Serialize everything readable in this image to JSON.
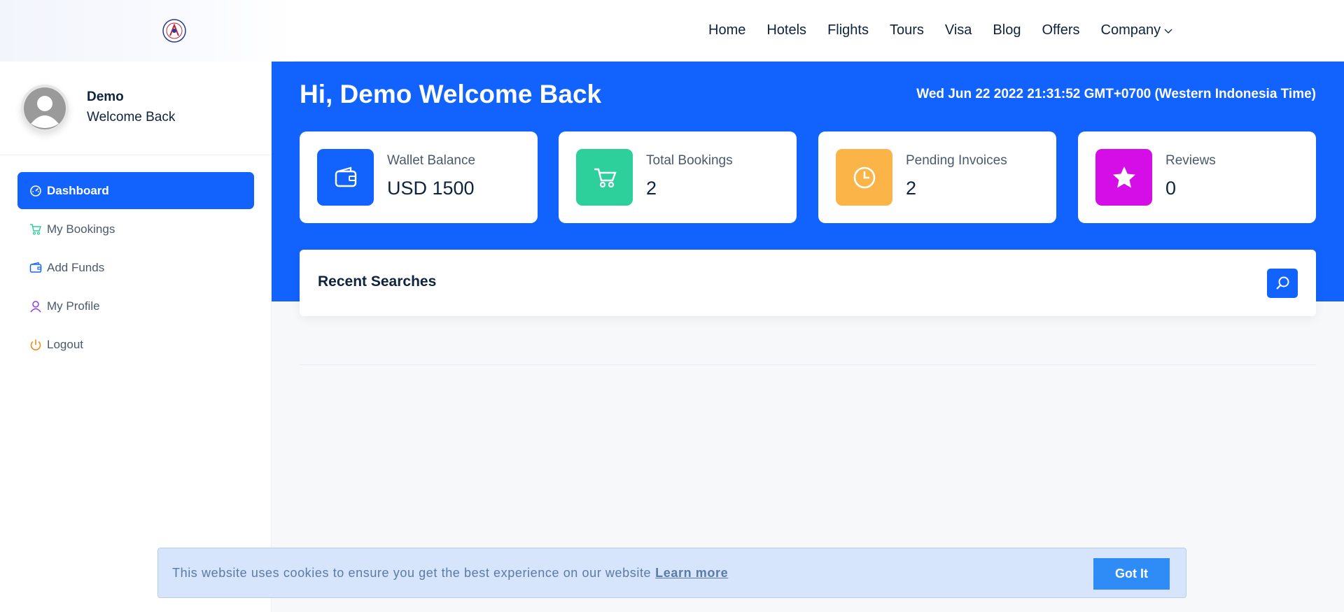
{
  "nav": {
    "items": [
      "Home",
      "Hotels",
      "Flights",
      "Tours",
      "Visa",
      "Blog",
      "Offers",
      "Company"
    ]
  },
  "sidebar": {
    "user_name": "Demo",
    "user_greeting": "Welcome Back",
    "items": [
      {
        "label": "Dashboard",
        "icon": "dashboard-gauge-icon",
        "color": "#ffffff",
        "active": true
      },
      {
        "label": "My Bookings",
        "icon": "cart-icon",
        "color": "#2dd09b",
        "active": false
      },
      {
        "label": "Add Funds",
        "icon": "wallet-icon",
        "color": "#1263fd",
        "active": false
      },
      {
        "label": "My Profile",
        "icon": "user-icon",
        "color": "#8a3cf5",
        "active": false
      },
      {
        "label": "Logout",
        "icon": "power-icon",
        "color": "#f08a1c",
        "active": false
      }
    ]
  },
  "hero": {
    "title": "Hi, Demo Welcome Back",
    "datetime": "Wed Jun 22 2022 21:31:52 GMT+0700 (Western Indonesia Time)"
  },
  "stats": [
    {
      "label": "Wallet Balance",
      "value": "USD 1500",
      "icon": "wallet-icon",
      "color": "#1263fd"
    },
    {
      "label": "Total Bookings",
      "value": "2",
      "icon": "cart-icon",
      "color": "#2dd09b"
    },
    {
      "label": "Pending Invoices",
      "value": "2",
      "icon": "clock-icon",
      "color": "#fbb448"
    },
    {
      "label": "Reviews",
      "value": "0",
      "icon": "star-icon",
      "color": "#d50ee8"
    }
  ],
  "recent": {
    "title": "Recent Searches",
    "button_icon": "search-icon"
  },
  "cookie": {
    "text": "This website uses cookies to ensure you get the best experience on our website",
    "link": "Learn more",
    "button": "Got It"
  },
  "colors": {
    "primary": "#1263fd",
    "cookie_bg": "#d6e4fc",
    "cookie_button": "#2f8cf7"
  }
}
